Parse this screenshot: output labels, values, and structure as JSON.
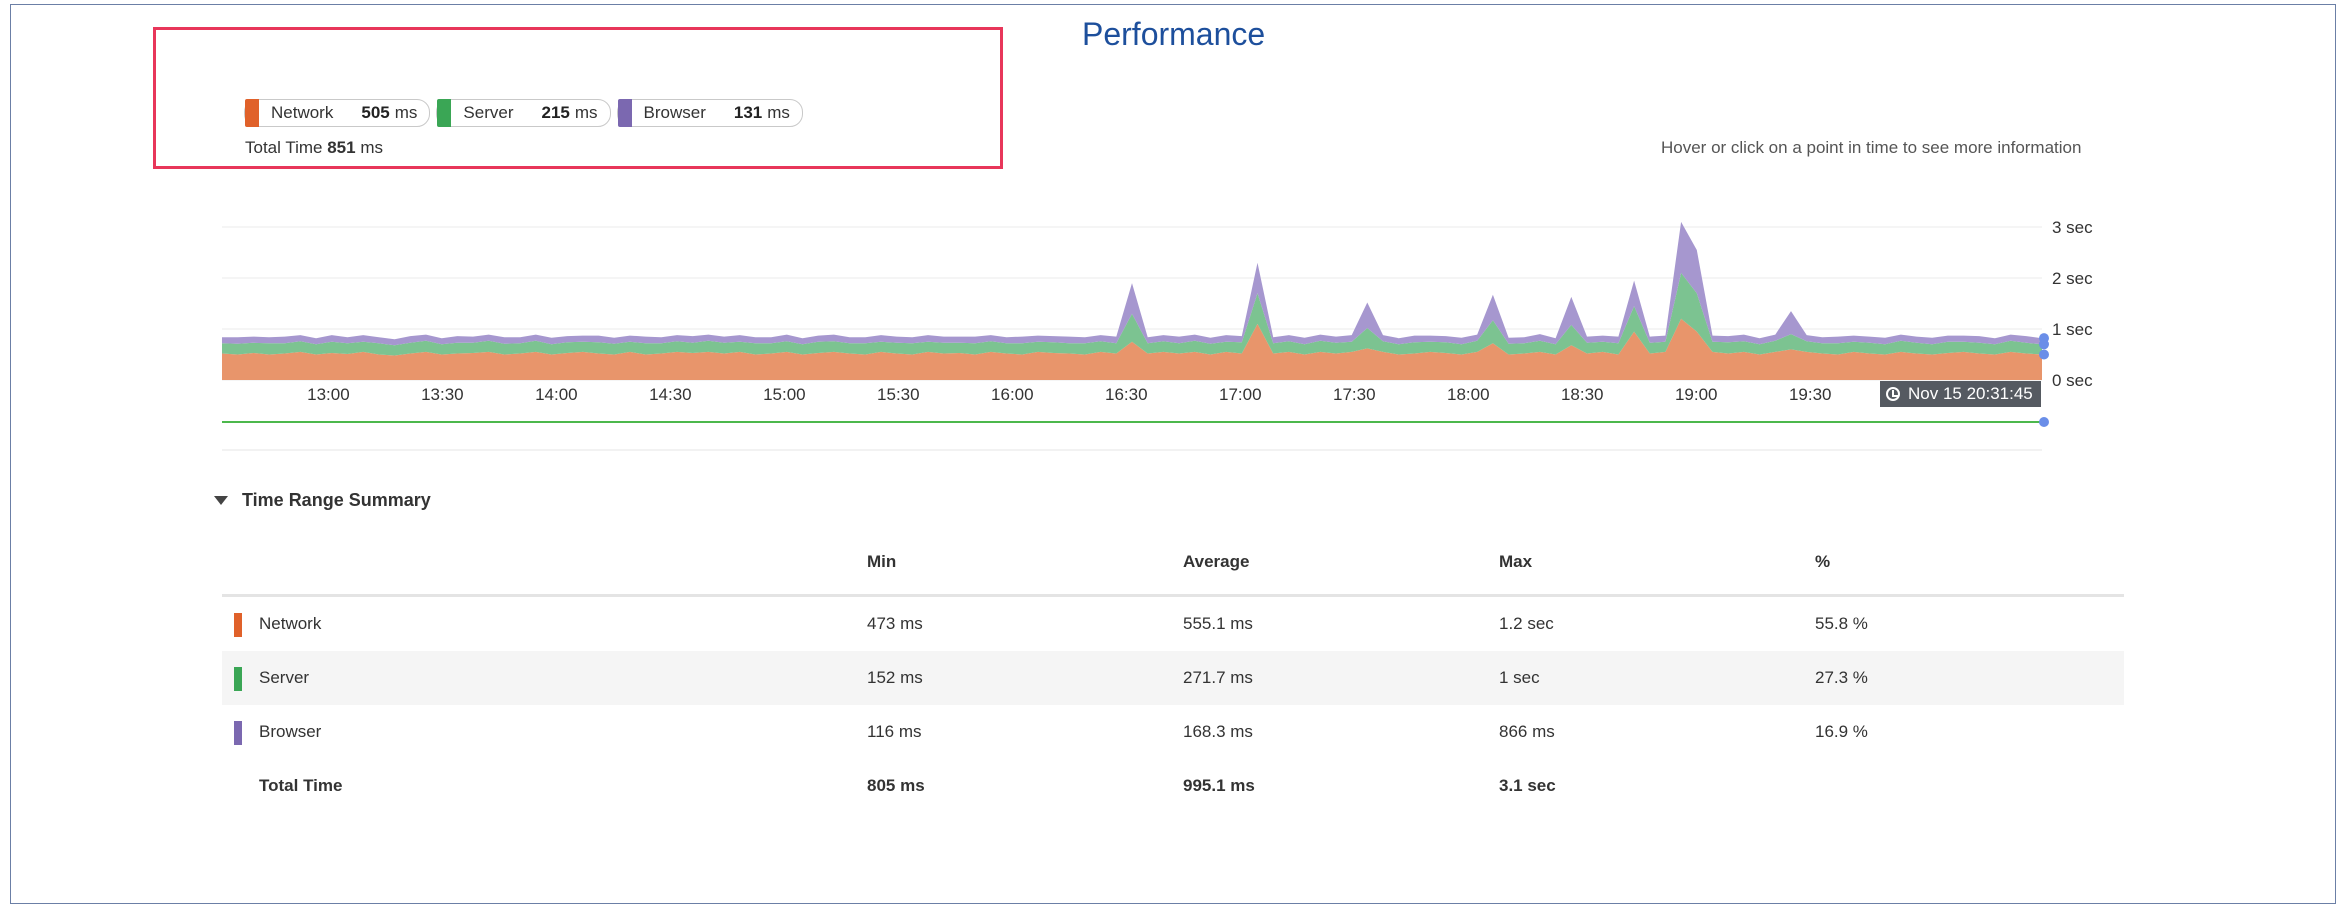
{
  "title": "Performance",
  "legend": [
    {
      "name": "Network",
      "value": "505",
      "unit": "ms",
      "color": "#e0612a"
    },
    {
      "name": "Server",
      "value": "215",
      "unit": "ms",
      "color": "#3aa655"
    },
    {
      "name": "Browser",
      "value": "131",
      "unit": "ms",
      "color": "#7b68b0"
    }
  ],
  "total": {
    "label": "Total Time",
    "value": "851",
    "unit": "ms"
  },
  "hover_hint": "Hover or click on a point in time to see more information",
  "timestamp": "Nov 15 20:31:45",
  "chart_data": {
    "type": "area",
    "stacked": true,
    "x_tick_labels": [
      "13:00",
      "13:30",
      "14:00",
      "14:30",
      "15:00",
      "15:30",
      "16:00",
      "16:30",
      "17:00",
      "17:30",
      "18:00",
      "18:30",
      "19:00",
      "19:30"
    ],
    "y_tick_labels": [
      "3 sec",
      "2 sec",
      "1 sec",
      "0 sec"
    ],
    "ylim": [
      0,
      3.1
    ],
    "y_unit": "sec",
    "x_range": [
      "12:32",
      "20:31"
    ],
    "grid": true,
    "series": [
      {
        "name": "Network",
        "color": "#e8956b",
        "values": [
          0.52,
          0.5,
          0.53,
          0.5,
          0.52,
          0.55,
          0.5,
          0.53,
          0.51,
          0.55,
          0.5,
          0.48,
          0.52,
          0.55,
          0.5,
          0.52,
          0.53,
          0.55,
          0.5,
          0.52,
          0.55,
          0.5,
          0.53,
          0.55,
          0.52,
          0.5,
          0.55,
          0.5,
          0.52,
          0.55,
          0.53,
          0.55,
          0.52,
          0.55,
          0.5,
          0.52,
          0.55,
          0.5,
          0.53,
          0.55,
          0.52,
          0.5,
          0.55,
          0.52,
          0.5,
          0.55,
          0.52,
          0.53,
          0.5,
          0.55,
          0.52,
          0.5,
          0.55,
          0.53,
          0.52,
          0.5,
          0.55,
          0.52,
          0.75,
          0.52,
          0.55,
          0.52,
          0.55,
          0.5,
          0.55,
          0.52,
          1.1,
          0.52,
          0.55,
          0.5,
          0.55,
          0.52,
          0.55,
          0.62,
          0.55,
          0.5,
          0.52,
          0.55,
          0.53,
          0.5,
          0.55,
          0.72,
          0.5,
          0.52,
          0.55,
          0.5,
          0.68,
          0.52,
          0.55,
          0.5,
          0.95,
          0.52,
          0.55,
          1.2,
          0.95,
          0.55,
          0.52,
          0.55,
          0.5,
          0.55,
          0.6,
          0.55,
          0.52,
          0.5,
          0.55,
          0.52,
          0.5,
          0.55,
          0.52,
          0.5,
          0.53,
          0.55,
          0.52,
          0.5,
          0.55,
          0.52,
          0.5
        ]
      },
      {
        "name": "Server",
        "color": "#7cc391",
        "values": [
          0.2,
          0.21,
          0.2,
          0.22,
          0.2,
          0.21,
          0.2,
          0.22,
          0.21,
          0.2,
          0.22,
          0.2,
          0.21,
          0.22,
          0.2,
          0.21,
          0.2,
          0.22,
          0.21,
          0.2,
          0.22,
          0.2,
          0.21,
          0.2,
          0.22,
          0.21,
          0.2,
          0.22,
          0.2,
          0.21,
          0.2,
          0.22,
          0.21,
          0.2,
          0.22,
          0.2,
          0.21,
          0.2,
          0.22,
          0.21,
          0.2,
          0.22,
          0.2,
          0.21,
          0.22,
          0.2,
          0.21,
          0.2,
          0.22,
          0.21,
          0.2,
          0.22,
          0.2,
          0.21,
          0.2,
          0.22,
          0.21,
          0.2,
          0.55,
          0.2,
          0.21,
          0.2,
          0.22,
          0.21,
          0.2,
          0.22,
          0.6,
          0.2,
          0.21,
          0.2,
          0.22,
          0.21,
          0.2,
          0.4,
          0.21,
          0.2,
          0.22,
          0.2,
          0.21,
          0.2,
          0.22,
          0.45,
          0.21,
          0.2,
          0.22,
          0.2,
          0.4,
          0.21,
          0.2,
          0.22,
          0.5,
          0.21,
          0.2,
          0.9,
          0.75,
          0.2,
          0.22,
          0.21,
          0.2,
          0.22,
          0.3,
          0.21,
          0.2,
          0.22,
          0.2,
          0.21,
          0.2,
          0.22,
          0.21,
          0.2,
          0.22,
          0.2,
          0.21,
          0.2,
          0.22,
          0.21,
          0.2
        ]
      },
      {
        "name": "Browser",
        "color": "#a697cf",
        "values": [
          0.12,
          0.13,
          0.12,
          0.12,
          0.13,
          0.12,
          0.12,
          0.13,
          0.12,
          0.13,
          0.12,
          0.12,
          0.13,
          0.12,
          0.12,
          0.13,
          0.12,
          0.12,
          0.13,
          0.12,
          0.12,
          0.13,
          0.12,
          0.12,
          0.13,
          0.12,
          0.12,
          0.13,
          0.12,
          0.12,
          0.13,
          0.12,
          0.12,
          0.13,
          0.12,
          0.12,
          0.13,
          0.12,
          0.12,
          0.13,
          0.12,
          0.12,
          0.13,
          0.12,
          0.12,
          0.13,
          0.12,
          0.12,
          0.13,
          0.12,
          0.12,
          0.13,
          0.12,
          0.12,
          0.13,
          0.12,
          0.12,
          0.13,
          0.6,
          0.12,
          0.12,
          0.13,
          0.12,
          0.12,
          0.13,
          0.12,
          0.6,
          0.12,
          0.12,
          0.13,
          0.12,
          0.12,
          0.13,
          0.5,
          0.12,
          0.12,
          0.13,
          0.12,
          0.12,
          0.13,
          0.12,
          0.5,
          0.12,
          0.12,
          0.13,
          0.12,
          0.55,
          0.12,
          0.12,
          0.13,
          0.5,
          0.12,
          0.12,
          1.0,
          0.85,
          0.12,
          0.12,
          0.13,
          0.12,
          0.12,
          0.45,
          0.12,
          0.12,
          0.13,
          0.12,
          0.12,
          0.13,
          0.12,
          0.12,
          0.13,
          0.12,
          0.12,
          0.13,
          0.12,
          0.12,
          0.13,
          0.12
        ]
      }
    ]
  },
  "summary": {
    "toggle_label": "Time Range Summary",
    "headers": {
      "min": "Min",
      "avg": "Average",
      "max": "Max",
      "pct": "%"
    },
    "rows": [
      {
        "name": "Network",
        "color": "#e0612a",
        "min": "473 ms",
        "avg": "555.1 ms",
        "max": "1.2 sec",
        "pct": "55.8 %"
      },
      {
        "name": "Server",
        "color": "#3aa655",
        "min": "152 ms",
        "avg": "271.7 ms",
        "max": "1 sec",
        "pct": "27.3 %"
      },
      {
        "name": "Browser",
        "color": "#7b68b0",
        "min": "116 ms",
        "avg": "168.3 ms",
        "max": "866 ms",
        "pct": "16.9 %"
      }
    ],
    "total": {
      "name": "Total Time",
      "min": "805 ms",
      "avg": "995.1 ms",
      "max": "3.1 sec"
    }
  }
}
